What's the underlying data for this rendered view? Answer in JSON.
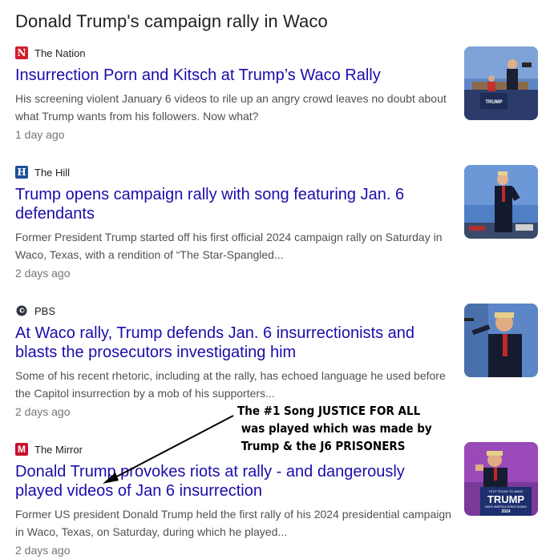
{
  "heading": "Donald Trump's campaign rally in Waco",
  "articles": [
    {
      "source": "The Nation",
      "logo_letter": "N",
      "logo_color": "#d01f2e",
      "title": "Insurrection Porn and Kitsch at Trump’s Waco Rally",
      "snippet": "His screening violent January 6 videos to rile up an angry crowd leaves no doubt about what Trump wants from his followers. Now what?",
      "age": "1 day ago",
      "image": "rally-stage-photo"
    },
    {
      "source": "The Hill",
      "logo_letter": "H",
      "logo_color": "#1f4f9a",
      "title": "Trump opens campaign rally with song featuring Jan. 6 defendants",
      "snippet": "Former President Trump started off his first official 2024 campaign rally on Saturday in Waco, Texas, with a rendition of “The Star-Spangled...",
      "age": "2 days ago",
      "image": "trump-saluting-photo"
    },
    {
      "source": "PBS",
      "logo_letter": "",
      "logo_color": "#2f3541",
      "title": "At Waco rally, Trump defends Jan. 6 insurrectionists and blasts the prosecutors investigating him",
      "snippet": "Some of his recent rhetoric, including at the rally, has echoed language he used before the Capitol insurrection by a mob of his supporters...",
      "age": "2 days ago",
      "image": "trump-speaking-photo"
    },
    {
      "source": "The Mirror",
      "logo_letter": "M",
      "logo_color": "#c8102e",
      "title": "Donald Trump provokes riots at rally - and dangerously played videos of Jan 6 insurrection",
      "snippet": "Former US president Donald Trump held the first rally of his 2024 presidential campaign in Waco, Texas, on Saturday, during which he played...",
      "age": "2 days ago",
      "image": "trump-podium-photo"
    }
  ],
  "annotation": "The #1 Song JUSTICE FOR ALL\n was played which was made by\n Trump & the J6 PRISONERS",
  "thumb_texts": {
    "sign_small": "TEXT TEXAS TO 88022",
    "sign_big": "TRUMP",
    "sign_sub": "MAKE AMERICA GREAT AGAIN!",
    "sign_year": "2024",
    "podium": "TRUMP"
  }
}
